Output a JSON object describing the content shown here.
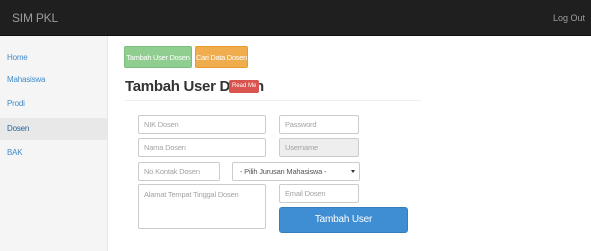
{
  "navbar": {
    "brand": "SIM PKL",
    "logout": "Log Out"
  },
  "sidebar": {
    "items": [
      {
        "label": "Home"
      },
      {
        "label": "Mahasiswa"
      },
      {
        "label": "Prodi"
      },
      {
        "label": "Dosen",
        "active": true
      },
      {
        "label": "BAK"
      }
    ]
  },
  "toolbar": {
    "tambah_label": "Tambah User Dosen",
    "cari_label": "Cari Data Dosen"
  },
  "main": {
    "title": "Tambah User Dosen",
    "badge": "Read Me"
  },
  "form": {
    "nik_placeholder": "NIK Dosen",
    "password_placeholder": "Password",
    "nama_placeholder": "Nama Dosen",
    "username_placeholder": "Username",
    "kontak_placeholder": "No Kontak Dosen",
    "jurusan_selected": "- Pilih Jurusan Mahasiswa -",
    "alamat_placeholder": "Alamat Tempat Tinggal Dosen",
    "email_placeholder": "Email Dosen",
    "submit_label": "Tambah User"
  },
  "colors": {
    "navbar": "#1f1f1f",
    "success": "#8fce8f",
    "warning": "#f0ad4e",
    "danger": "#d9534f",
    "primary": "#3f8ed3",
    "link": "#428bca"
  }
}
